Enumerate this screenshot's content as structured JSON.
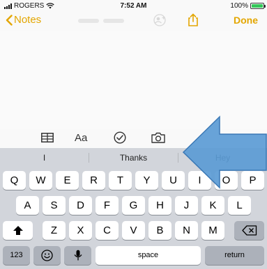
{
  "status": {
    "carrier": "ROGERS",
    "time": "7:52 AM",
    "battery": "100%",
    "battery_level": 1.0
  },
  "nav": {
    "back_label": "Notes",
    "faded_title": "Notes title",
    "done_label": "Done"
  },
  "toolbar": {
    "format_label": "Aa"
  },
  "predictions": [
    "I",
    "Thanks",
    "Hey"
  ],
  "keyboard": {
    "row1": [
      "Q",
      "W",
      "E",
      "R",
      "T",
      "Y",
      "U",
      "I",
      "O",
      "P"
    ],
    "row2": [
      "A",
      "S",
      "D",
      "F",
      "G",
      "H",
      "J",
      "K",
      "L"
    ],
    "row3": [
      "Z",
      "X",
      "C",
      "V",
      "B",
      "N",
      "M"
    ],
    "numbers_label": "123",
    "space_label": "space",
    "return_label": "return"
  },
  "colors": {
    "accent": "#e3a600",
    "arrow": "#5b9bd5"
  },
  "icons": [
    "wifi-icon",
    "chevron-left-icon",
    "collaborate-icon",
    "share-icon",
    "table-icon",
    "checklist-icon",
    "camera-icon",
    "shift-icon",
    "delete-icon",
    "emoji-icon",
    "microphone-icon",
    "arrow-annotation"
  ]
}
